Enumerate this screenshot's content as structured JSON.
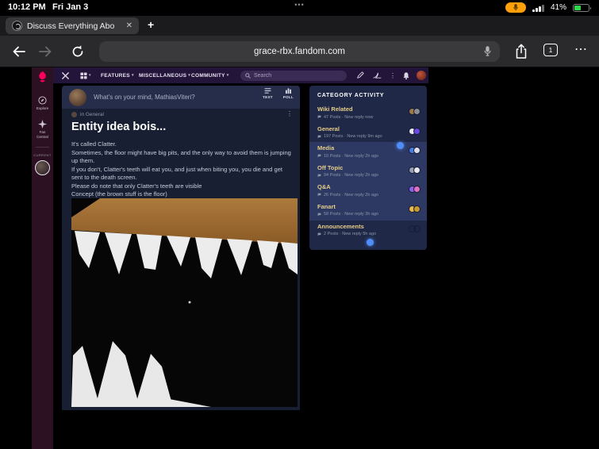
{
  "status_bar": {
    "time": "10:12 PM",
    "date": "Fri Jan 3",
    "battery_percent": "41%"
  },
  "browser": {
    "tab_title": "Discuss Everything Abo",
    "url": "grace-rbx.fandom.com",
    "tab_count": "1"
  },
  "icons": {
    "caret_down": "▾",
    "kebab": "⋮",
    "ellipsis": "⋯",
    "close": "✕",
    "plus": "+",
    "multitask": "•••"
  },
  "rail": {
    "explore_label": "Explore",
    "fan_central_line1": "Fan",
    "fan_central_line2": "Central",
    "current_label": "CURRENT"
  },
  "nav": {
    "menu": [
      {
        "label": "FEATURES"
      },
      {
        "label": "MISCELLANEOUS"
      },
      {
        "label": "COMMUNITY"
      }
    ],
    "search_placeholder": "Search"
  },
  "composer": {
    "prompt": "What's on your mind, MathiasViteri?",
    "text_label": "TEXT",
    "poll_label": "POLL"
  },
  "post": {
    "category_label": "in General",
    "title": "Entity idea bois...",
    "body": [
      "It's called Clatter.",
      "Sometimes, the floor might have big pits, and the only way to avoid them is jumping up them.",
      "If you don't, Clatter's teeth will eat you, and just when biting you, you die and get sent to the death screen.",
      "Please do note that only Clatter's teeth are visible",
      "Concept (the brown stuff is the floor)"
    ]
  },
  "sidebar": {
    "title": "CATEGORY ACTIVITY",
    "categories": [
      {
        "name": "Wiki Related",
        "meta": "47 Posts · New reply now",
        "highlighted": false
      },
      {
        "name": "General",
        "meta": "197 Posts · New reply 9m ago",
        "highlighted": false
      },
      {
        "name": "Media",
        "meta": "10 Posts · New reply 2h ago",
        "highlighted": true
      },
      {
        "name": "Off Topic",
        "meta": "94 Posts · New reply 2h ago",
        "highlighted": true
      },
      {
        "name": "Q&A",
        "meta": "26 Posts · New reply 2h ago",
        "highlighted": true
      },
      {
        "name": "Fanart",
        "meta": "58 Posts · New reply 3h ago",
        "highlighted": true
      },
      {
        "name": "Announcements",
        "meta": "2 Posts · New reply 5h ago",
        "highlighted": false
      }
    ]
  },
  "colors": {
    "category_link": "#e5cd8a",
    "fandom_brand": "#fa005a",
    "highlight_row": "#2d3963",
    "pointer_blue": "#4f8df9",
    "floor_brown": "#a9763a"
  }
}
